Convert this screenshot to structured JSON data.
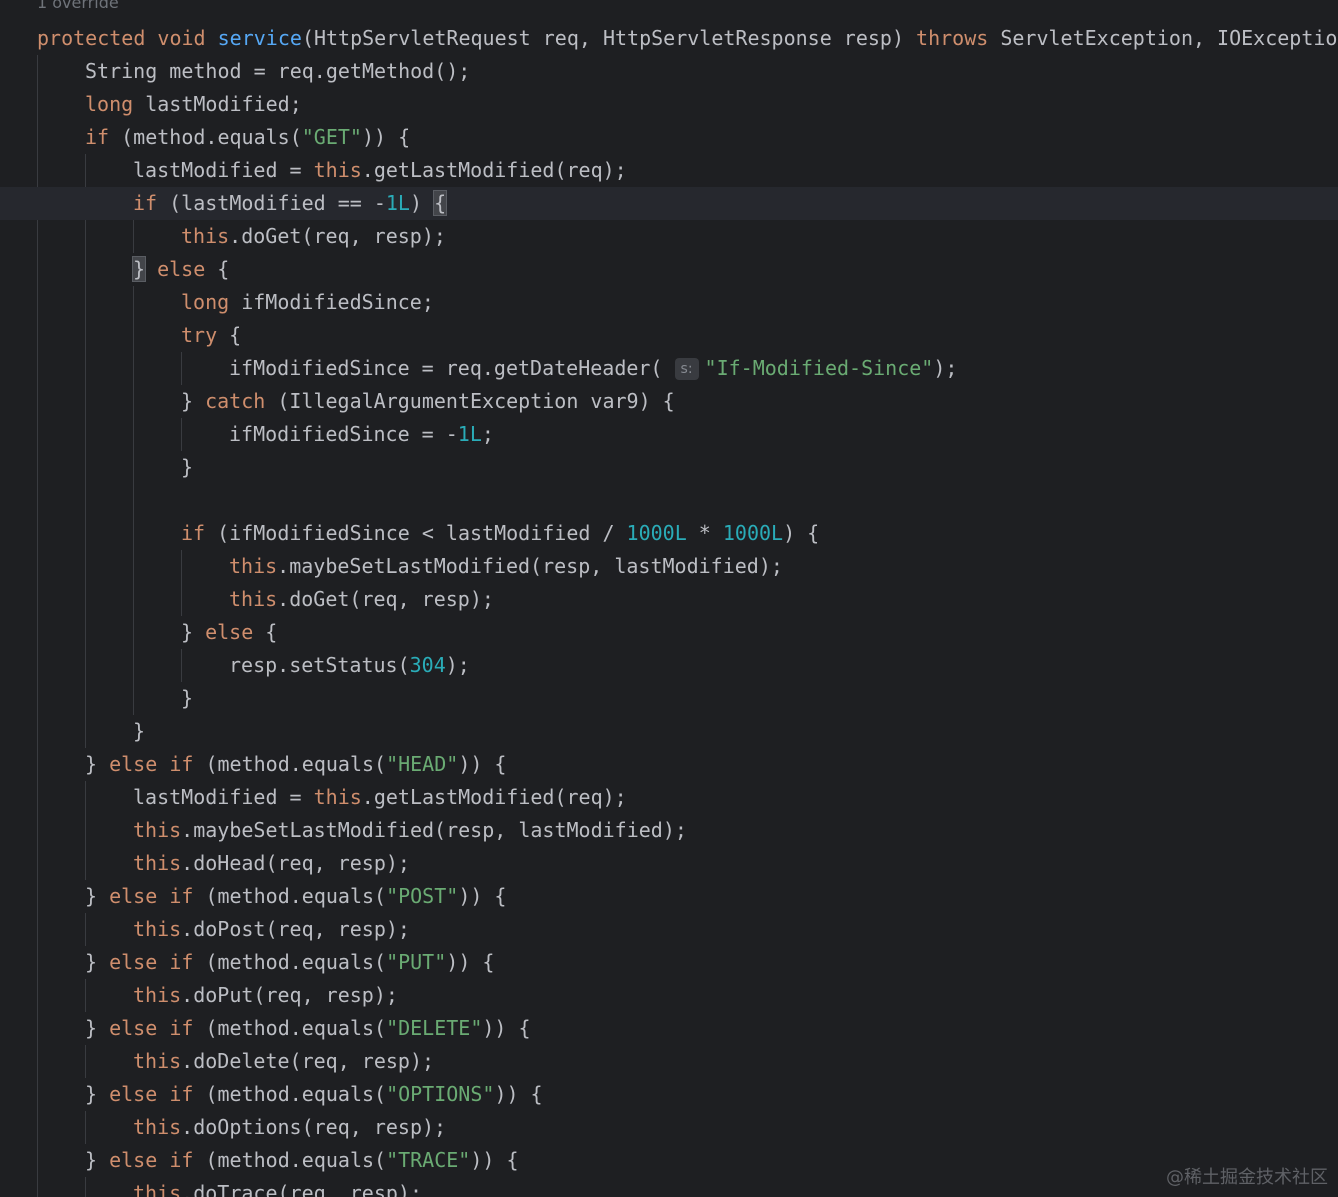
{
  "editor": {
    "usage_hint": "1 override",
    "watermark": "@稀土掘金技术社区",
    "theme_colors": {
      "background": "#1e1f22",
      "text": "#bcbec4",
      "keyword": "#cf8e6d",
      "method": "#56a8f5",
      "string": "#6aab73",
      "number": "#2aacb8",
      "current_line": "#26282e"
    },
    "lines": [
      {
        "indent": 0,
        "tokens": [
          {
            "t": "protected",
            "c": "kw"
          },
          {
            "t": " "
          },
          {
            "t": "void",
            "c": "kw"
          },
          {
            "t": " "
          },
          {
            "t": "service",
            "c": "fn"
          },
          {
            "t": "(HttpServletRequest req, HttpServletResponse resp) "
          },
          {
            "t": "throws",
            "c": "kw"
          },
          {
            "t": " ServletException, IOException {"
          }
        ]
      },
      {
        "indent": 1,
        "tokens": [
          {
            "t": "String method = req.getMethod();"
          }
        ]
      },
      {
        "indent": 1,
        "tokens": [
          {
            "t": "long",
            "c": "kw"
          },
          {
            "t": " lastModified;"
          }
        ]
      },
      {
        "indent": 1,
        "tokens": [
          {
            "t": "if",
            "c": "kw"
          },
          {
            "t": " (method.equals("
          },
          {
            "t": "\"GET\"",
            "c": "str"
          },
          {
            "t": ")) {"
          }
        ]
      },
      {
        "indent": 2,
        "tokens": [
          {
            "t": "lastModified = "
          },
          {
            "t": "this",
            "c": "kw"
          },
          {
            "t": ".getLastModified(req);"
          }
        ]
      },
      {
        "indent": 2,
        "current": true,
        "tokens": [
          {
            "t": "if",
            "c": "kw"
          },
          {
            "t": " (lastModified == -"
          },
          {
            "t": "1L",
            "c": "num"
          },
          {
            "t": ") "
          },
          {
            "t": "{",
            "c": "bracehl"
          }
        ]
      },
      {
        "indent": 3,
        "tokens": [
          {
            "t": "this",
            "c": "kw"
          },
          {
            "t": ".doGet(req, resp);"
          }
        ]
      },
      {
        "indent": 2,
        "tokens": [
          {
            "t": "}",
            "c": "bracehl"
          },
          {
            "t": " "
          },
          {
            "t": "else",
            "c": "kw"
          },
          {
            "t": " {"
          }
        ]
      },
      {
        "indent": 3,
        "tokens": [
          {
            "t": "long",
            "c": "kw"
          },
          {
            "t": " ifModifiedSince;"
          }
        ]
      },
      {
        "indent": 3,
        "tokens": [
          {
            "t": "try",
            "c": "kw"
          },
          {
            "t": " {"
          }
        ]
      },
      {
        "indent": 4,
        "tokens": [
          {
            "t": "ifModifiedSince = req.getDateHeader( "
          },
          {
            "t": "s:",
            "c": "inlay"
          },
          {
            "t": "\"If-Modified-Since\"",
            "c": "str"
          },
          {
            "t": ");"
          }
        ]
      },
      {
        "indent": 3,
        "tokens": [
          {
            "t": "} "
          },
          {
            "t": "catch",
            "c": "kw"
          },
          {
            "t": " (IllegalArgumentException var9) {"
          }
        ]
      },
      {
        "indent": 4,
        "tokens": [
          {
            "t": "ifModifiedSince = -"
          },
          {
            "t": "1L",
            "c": "num"
          },
          {
            "t": ";"
          }
        ]
      },
      {
        "indent": 3,
        "tokens": [
          {
            "t": "}"
          }
        ]
      },
      {
        "indent": 0,
        "tokens": []
      },
      {
        "indent": 3,
        "tokens": [
          {
            "t": "if",
            "c": "kw"
          },
          {
            "t": " (ifModifiedSince < lastModified / "
          },
          {
            "t": "1000L",
            "c": "num"
          },
          {
            "t": " * "
          },
          {
            "t": "1000L",
            "c": "num"
          },
          {
            "t": ") {"
          }
        ]
      },
      {
        "indent": 4,
        "tokens": [
          {
            "t": "this",
            "c": "kw"
          },
          {
            "t": ".maybeSetLastModified(resp, lastModified);"
          }
        ]
      },
      {
        "indent": 4,
        "tokens": [
          {
            "t": "this",
            "c": "kw"
          },
          {
            "t": ".doGet(req, resp);"
          }
        ]
      },
      {
        "indent": 3,
        "tokens": [
          {
            "t": "} "
          },
          {
            "t": "else",
            "c": "kw"
          },
          {
            "t": " {"
          }
        ]
      },
      {
        "indent": 4,
        "tokens": [
          {
            "t": "resp.setStatus("
          },
          {
            "t": "304",
            "c": "num"
          },
          {
            "t": ");"
          }
        ]
      },
      {
        "indent": 3,
        "tokens": [
          {
            "t": "}"
          }
        ]
      },
      {
        "indent": 2,
        "tokens": [
          {
            "t": "}"
          }
        ]
      },
      {
        "indent": 1,
        "tokens": [
          {
            "t": "} "
          },
          {
            "t": "else",
            "c": "kw"
          },
          {
            "t": " "
          },
          {
            "t": "if",
            "c": "kw"
          },
          {
            "t": " (method.equals("
          },
          {
            "t": "\"HEAD\"",
            "c": "str"
          },
          {
            "t": ")) {"
          }
        ]
      },
      {
        "indent": 2,
        "tokens": [
          {
            "t": "lastModified = "
          },
          {
            "t": "this",
            "c": "kw"
          },
          {
            "t": ".getLastModified(req);"
          }
        ]
      },
      {
        "indent": 2,
        "tokens": [
          {
            "t": "this",
            "c": "kw"
          },
          {
            "t": ".maybeSetLastModified(resp, lastModified);"
          }
        ]
      },
      {
        "indent": 2,
        "tokens": [
          {
            "t": "this",
            "c": "kw"
          },
          {
            "t": ".doHead(req, resp);"
          }
        ]
      },
      {
        "indent": 1,
        "tokens": [
          {
            "t": "} "
          },
          {
            "t": "else",
            "c": "kw"
          },
          {
            "t": " "
          },
          {
            "t": "if",
            "c": "kw"
          },
          {
            "t": " (method.equals("
          },
          {
            "t": "\"POST\"",
            "c": "str"
          },
          {
            "t": ")) {"
          }
        ]
      },
      {
        "indent": 2,
        "tokens": [
          {
            "t": "this",
            "c": "kw"
          },
          {
            "t": ".doPost(req, resp);"
          }
        ]
      },
      {
        "indent": 1,
        "tokens": [
          {
            "t": "} "
          },
          {
            "t": "else",
            "c": "kw"
          },
          {
            "t": " "
          },
          {
            "t": "if",
            "c": "kw"
          },
          {
            "t": " (method.equals("
          },
          {
            "t": "\"PUT\"",
            "c": "str"
          },
          {
            "t": ")) {"
          }
        ]
      },
      {
        "indent": 2,
        "tokens": [
          {
            "t": "this",
            "c": "kw"
          },
          {
            "t": ".doPut(req, resp);"
          }
        ]
      },
      {
        "indent": 1,
        "tokens": [
          {
            "t": "} "
          },
          {
            "t": "else",
            "c": "kw"
          },
          {
            "t": " "
          },
          {
            "t": "if",
            "c": "kw"
          },
          {
            "t": " (method.equals("
          },
          {
            "t": "\"DELETE\"",
            "c": "str"
          },
          {
            "t": ")) {"
          }
        ]
      },
      {
        "indent": 2,
        "tokens": [
          {
            "t": "this",
            "c": "kw"
          },
          {
            "t": ".doDelete(req, resp);"
          }
        ]
      },
      {
        "indent": 1,
        "tokens": [
          {
            "t": "} "
          },
          {
            "t": "else",
            "c": "kw"
          },
          {
            "t": " "
          },
          {
            "t": "if",
            "c": "kw"
          },
          {
            "t": " (method.equals("
          },
          {
            "t": "\"OPTIONS\"",
            "c": "str"
          },
          {
            "t": ")) {"
          }
        ]
      },
      {
        "indent": 2,
        "tokens": [
          {
            "t": "this",
            "c": "kw"
          },
          {
            "t": ".doOptions(req, resp);"
          }
        ]
      },
      {
        "indent": 1,
        "tokens": [
          {
            "t": "} "
          },
          {
            "t": "else",
            "c": "kw"
          },
          {
            "t": " "
          },
          {
            "t": "if",
            "c": "kw"
          },
          {
            "t": " (method.equals("
          },
          {
            "t": "\"TRACE\"",
            "c": "str"
          },
          {
            "t": ")) {"
          }
        ]
      },
      {
        "indent": 2,
        "tokens": [
          {
            "t": "this",
            "c": "kw"
          },
          {
            "t": ".doTrace(req, resp);"
          }
        ]
      }
    ]
  }
}
